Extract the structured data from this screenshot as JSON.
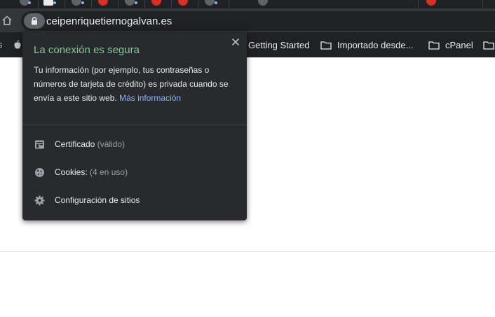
{
  "browser": {
    "url": "ceipenriquetiernogalvan.es",
    "home_icon": "home-icon",
    "lock_icon": "lock-icon"
  },
  "bookmarks_bar": {
    "items": [
      {
        "label": "Getting Started",
        "icon": "none"
      },
      {
        "label": "Importado desde...",
        "icon": "folder-icon"
      },
      {
        "label": "cPanel",
        "icon": "folder-icon"
      }
    ]
  },
  "site_info_popup": {
    "title": "La conexión es segura",
    "description": "Tu información (por ejemplo, tus contraseñas o números de tarjeta de crédito) es privada cuando se envía a este sitio web.",
    "link_label": "Más información",
    "rows": [
      {
        "label": "Certificado",
        "status": "(válido)",
        "icon": "certificate-icon"
      },
      {
        "label": "Cookies:",
        "status": "(4 en uso)",
        "icon": "cookie-icon"
      },
      {
        "label": "Configuración de sitios",
        "status": "",
        "icon": "gear-icon"
      }
    ]
  },
  "colors": {
    "secure_green": "#81c995",
    "link_blue": "#8ab4f8",
    "popup_background": "#292a2d",
    "toolbar_background": "#35363a"
  }
}
